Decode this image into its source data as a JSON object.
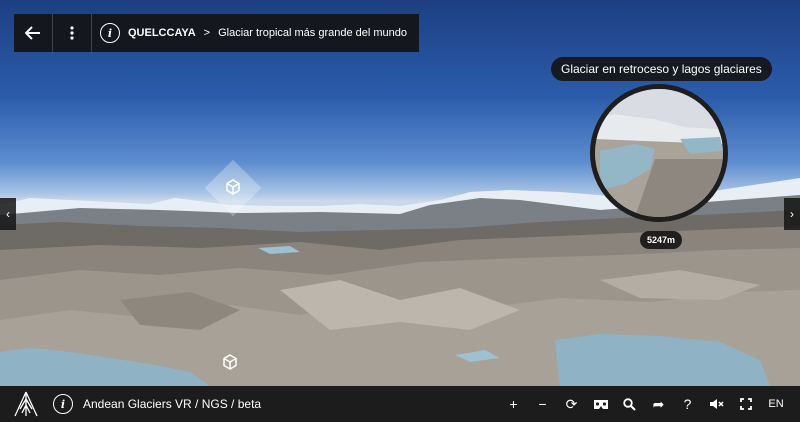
{
  "header": {
    "back_icon": "arrow-left-icon",
    "menu_icon": "vertical-dots-icon",
    "info_icon": "info-icon",
    "title": "QUELCCAYA",
    "separator": ">",
    "subtitle": "Glaciar tropical más grande del mundo"
  },
  "poi": {
    "label": "Glaciar en retroceso y lagos glaciares",
    "altitude": "5247m"
  },
  "nav": {
    "left_arrow": "‹",
    "right_arrow": "›"
  },
  "footer": {
    "title": "Andean Glaciers VR / NGS / beta",
    "tools": {
      "zoom_in": "+",
      "zoom_out": "−",
      "rotate": "⟳",
      "vr": "VR",
      "search": "⚲",
      "share": "➦",
      "help": "?",
      "mute": "🔇",
      "fullscreen": "⛶",
      "language": "EN"
    }
  },
  "colors": {
    "sky_top": "#1d3f82",
    "bar_bg": "#1c1c1c",
    "lake": "#8fb3c4"
  }
}
